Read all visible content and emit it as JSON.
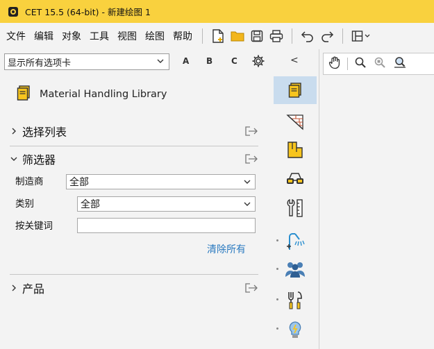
{
  "window": {
    "title": "CET 15.5 (64-bit) - 新建绘图 1",
    "accent": "#f9d13e"
  },
  "menu": {
    "items": [
      "文件",
      "编辑",
      "对象",
      "工具",
      "视图",
      "绘图",
      "帮助"
    ]
  },
  "toolbar": {
    "icons": [
      "new-file-icon",
      "open-folder-icon",
      "save-icon",
      "print-icon",
      "undo-icon",
      "redo-icon",
      "layout-icon"
    ]
  },
  "tab_selector": {
    "value": "显示所有选项卡"
  },
  "tab_letters": [
    "A",
    "B",
    "C"
  ],
  "collapse_glyph": "<",
  "library": {
    "title": "Material Handling Library"
  },
  "sections": {
    "select_list": "选择列表",
    "filter": "筛选器",
    "products": "产品"
  },
  "filter": {
    "manufacturer_label": "制造商",
    "manufacturer_value": "全部",
    "category_label": "类别",
    "category_value": "全部",
    "keyword_label": "按关键词",
    "keyword_value": "",
    "clear_all": "清除所有"
  },
  "colors": {
    "link": "#2a7ac0",
    "tool_active": "#c9dcee"
  }
}
